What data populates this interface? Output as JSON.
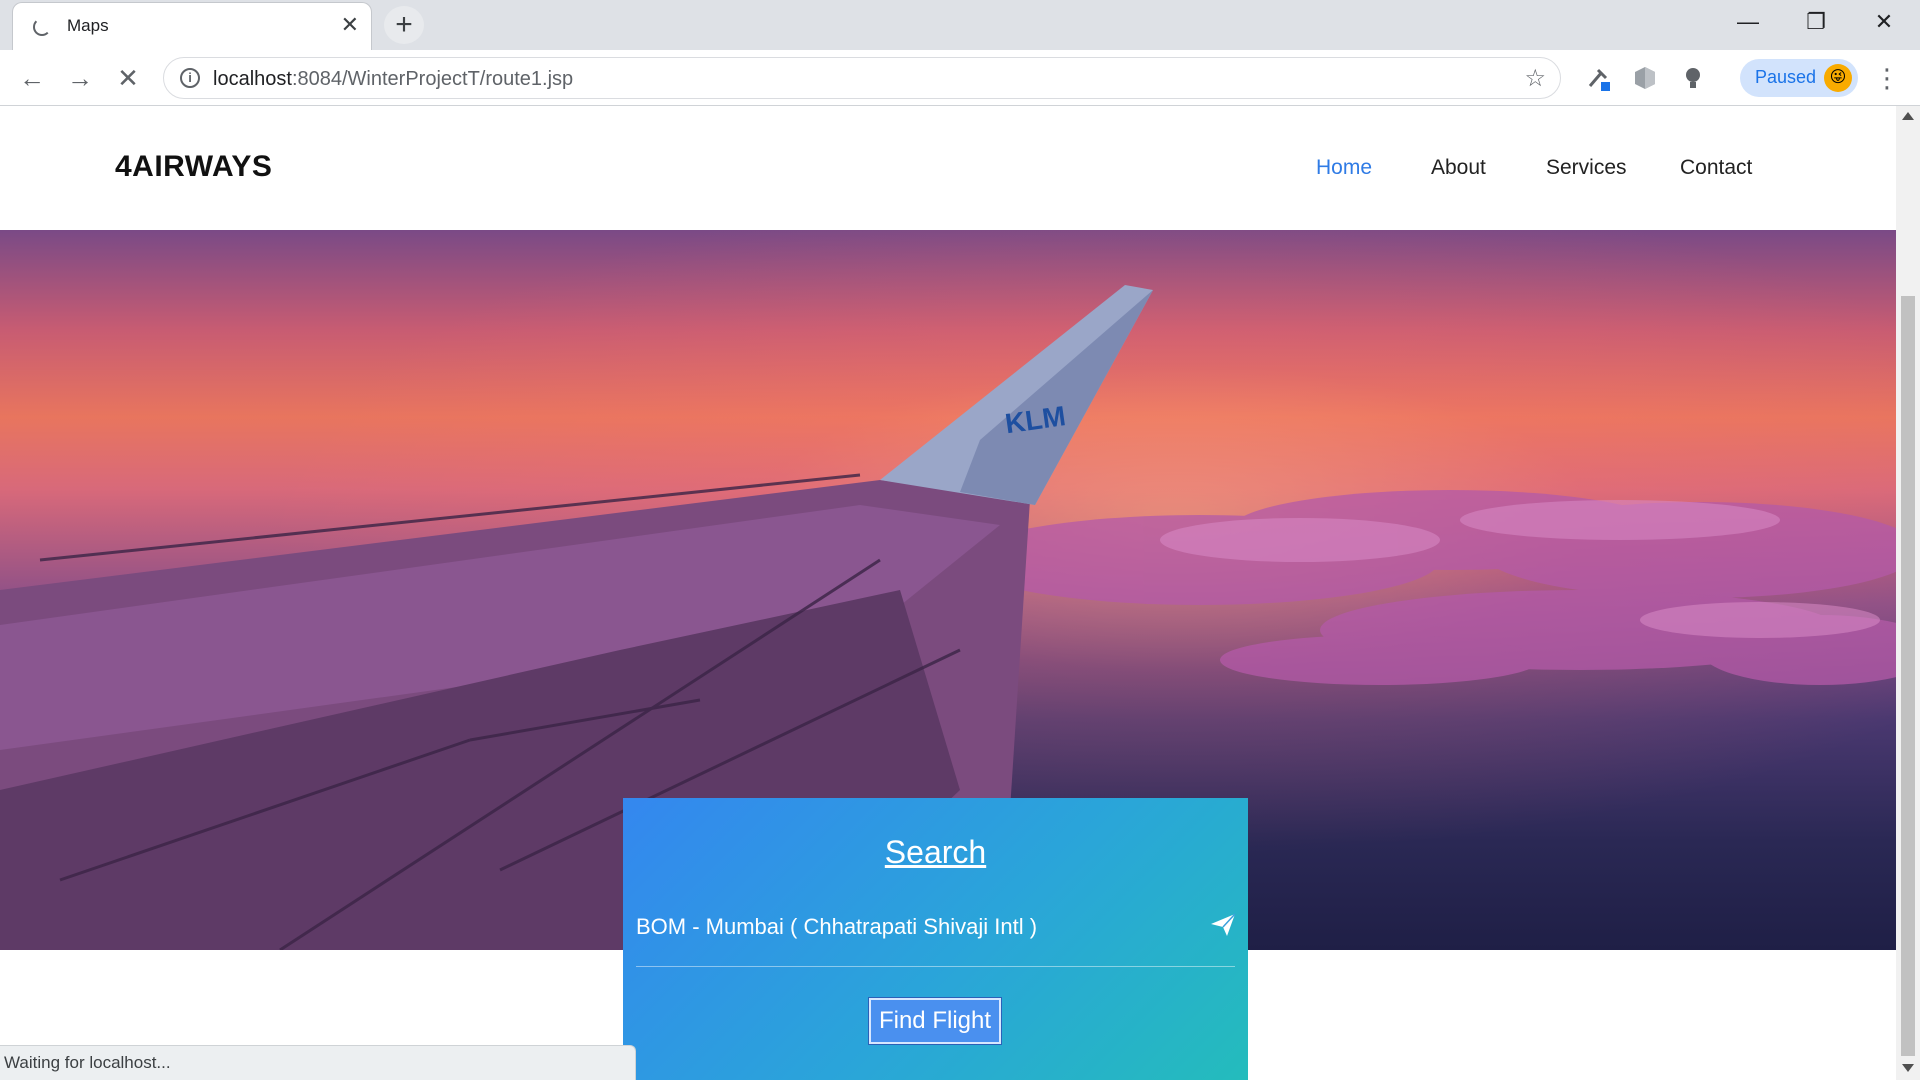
{
  "browser": {
    "tab_title": "Maps",
    "url_host": "localhost",
    "url_path": ":8084/WinterProjectT/route1.jsp",
    "profile_status": "Paused",
    "status_text": "Waiting for localhost..."
  },
  "site": {
    "brand": "4AIRWAYS",
    "nav": [
      "Home",
      "About",
      "Services",
      "Contact"
    ],
    "active_nav": "Home",
    "accent_color": "#2f7be5"
  },
  "hero": {
    "tail_logo": "KLM"
  },
  "search": {
    "title": "Search",
    "route": "BOM - Mumbai ( Chhatrapati Shivaji Intl )",
    "button_label": "Find Flight",
    "gradient_start": "#3487ef",
    "gradient_end": "#24bcbc"
  },
  "icons": [
    "tab-loading-icon",
    "close-icon",
    "new-tab-icon",
    "back-icon",
    "forward-icon",
    "stop-icon",
    "info-icon",
    "star-icon",
    "extension-icon",
    "shield-icon",
    "bulb-icon",
    "menu-icon",
    "paper-plane-icon"
  ]
}
